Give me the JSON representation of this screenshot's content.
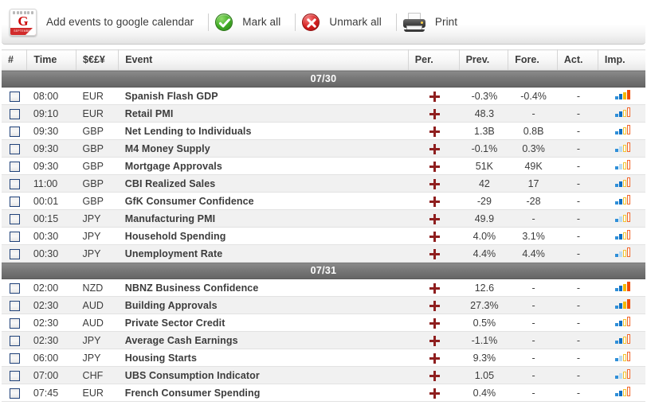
{
  "toolbar": {
    "items": [
      {
        "icon": "google-calendar-icon",
        "label": "Add events to google calendar"
      },
      {
        "icon": "check-circle-icon",
        "label": "Mark all"
      },
      {
        "icon": "x-circle-icon",
        "label": "Unmark all"
      },
      {
        "icon": "printer-icon",
        "label": "Print"
      }
    ],
    "gcal_band_text": "SEPTEMBER"
  },
  "table": {
    "headers": {
      "num": "#",
      "time": "Time",
      "currency": "$€£¥",
      "event": "Event",
      "per": "Per.",
      "prev": "Prev.",
      "fore": "Fore.",
      "act": "Act.",
      "imp": "Imp."
    },
    "groups": [
      {
        "date": "07/30",
        "rows": [
          {
            "time": "08:00",
            "currency": "EUR",
            "event": "Spanish Flash GDP",
            "per": "+",
            "prev": "-0.3%",
            "fore": "-0.4%",
            "act": "-",
            "imp": 4
          },
          {
            "time": "09:10",
            "currency": "EUR",
            "event": "Retail PMI",
            "per": "+",
            "prev": "48.3",
            "fore": "-",
            "act": "-",
            "imp": 2
          },
          {
            "time": "09:30",
            "currency": "GBP",
            "event": "Net Lending to Individuals",
            "per": "+",
            "prev": "1.3B",
            "fore": "0.8B",
            "act": "-",
            "imp": 2
          },
          {
            "time": "09:30",
            "currency": "GBP",
            "event": "M4 Money Supply",
            "per": "+",
            "prev": "-0.1%",
            "fore": "0.3%",
            "act": "-",
            "imp": 1
          },
          {
            "time": "09:30",
            "currency": "GBP",
            "event": "Mortgage Approvals",
            "per": "+",
            "prev": "51K",
            "fore": "49K",
            "act": "-",
            "imp": 1
          },
          {
            "time": "11:00",
            "currency": "GBP",
            "event": "CBI Realized Sales",
            "per": "+",
            "prev": "42",
            "fore": "17",
            "act": "-",
            "imp": 2
          },
          {
            "time": "00:01",
            "currency": "GBP",
            "event": "GfK Consumer Confidence",
            "per": "+",
            "prev": "-29",
            "fore": "-28",
            "act": "-",
            "imp": 2
          },
          {
            "time": "00:15",
            "currency": "JPY",
            "event": "Manufacturing PMI",
            "per": "+",
            "prev": "49.9",
            "fore": "-",
            "act": "-",
            "imp": 1
          },
          {
            "time": "00:30",
            "currency": "JPY",
            "event": "Household Spending",
            "per": "+",
            "prev": "4.0%",
            "fore": "3.1%",
            "act": "-",
            "imp": 2
          },
          {
            "time": "00:30",
            "currency": "JPY",
            "event": "Unemployment Rate",
            "per": "+",
            "prev": "4.4%",
            "fore": "4.4%",
            "act": "-",
            "imp": 1
          }
        ]
      },
      {
        "date": "07/31",
        "rows": [
          {
            "time": "02:00",
            "currency": "NZD",
            "event": "NBNZ Business Confidence",
            "per": "+",
            "prev": "12.6",
            "fore": "-",
            "act": "-",
            "imp": 4
          },
          {
            "time": "02:30",
            "currency": "AUD",
            "event": "Building Approvals",
            "per": "+",
            "prev": "27.3%",
            "fore": "-",
            "act": "-",
            "imp": 4
          },
          {
            "time": "02:30",
            "currency": "AUD",
            "event": "Private Sector Credit",
            "per": "+",
            "prev": "0.5%",
            "fore": "-",
            "act": "-",
            "imp": 2
          },
          {
            "time": "02:30",
            "currency": "JPY",
            "event": "Average Cash Earnings",
            "per": "+",
            "prev": "-1.1%",
            "fore": "-",
            "act": "-",
            "imp": 2
          },
          {
            "time": "06:00",
            "currency": "JPY",
            "event": "Housing Starts",
            "per": "+",
            "prev": "9.3%",
            "fore": "-",
            "act": "-",
            "imp": 1
          },
          {
            "time": "07:00",
            "currency": "CHF",
            "event": "UBS Consumption Indicator",
            "per": "+",
            "prev": "1.05",
            "fore": "-",
            "act": "-",
            "imp": 1
          },
          {
            "time": "07:45",
            "currency": "EUR",
            "event": "French Consumer Spending",
            "per": "+",
            "prev": "0.4%",
            "fore": "-",
            "act": "-",
            "imp": 2
          }
        ]
      }
    ]
  }
}
